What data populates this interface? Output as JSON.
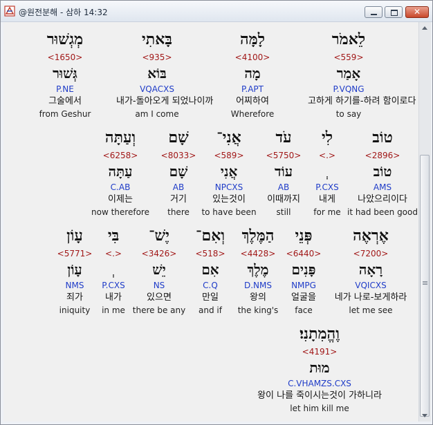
{
  "window": {
    "title": "@원전분해 - 삼하 14:32"
  },
  "rows": [
    [
      {
        "hebrew": "מְגְשׁוּר",
        "strong": "<1650>",
        "root": "גְּשׁוּר",
        "morph": "P.NE",
        "korean": "그술에서",
        "english": "from Geshur"
      },
      {
        "hebrew": "בָּאתִי",
        "strong": "<935>",
        "root": "בּוֹא",
        "morph": "VQACXS",
        "korean": "내가-돌아오게 되었나이까",
        "english": "am I come"
      },
      {
        "hebrew": "לָמָּה",
        "strong": "<4100>",
        "root": "מָה",
        "morph": "P.APT",
        "korean": "어찌하여",
        "english": "Wherefore"
      },
      {
        "hebrew": "לֵאמֹר",
        "strong": "<559>",
        "root": "אָמַר",
        "morph": "P.VQNG",
        "korean": "고하게 하기를-하려 함이로다",
        "english": "to say"
      }
    ],
    [
      {
        "hebrew": "וְעַתָּה",
        "strong": "<6258>",
        "root": "עַתָּה",
        "morph": "C.AB",
        "korean": "이제는",
        "english": "now therefore"
      },
      {
        "hebrew": "שָׁם",
        "strong": "<8033>",
        "root": "שָׁם",
        "morph": "AB",
        "korean": "거기",
        "english": "there"
      },
      {
        "hebrew": "אֲנִי־",
        "strong": "<589>",
        "root": "אֲנִי",
        "morph": "NPCXS",
        "korean": "있는것이",
        "english": "to have been"
      },
      {
        "hebrew": "עֹד",
        "strong": "<5750>",
        "root": "עוֹד",
        "morph": "AB",
        "korean": "이때까지",
        "english": "still"
      },
      {
        "hebrew": "לִי",
        "strong": "<.>",
        "root": "ְ",
        "morph": "P.CXS",
        "korean": "내게",
        "english": "for me"
      },
      {
        "hebrew": "טוֹב",
        "strong": "<2896>",
        "root": "טוֹב",
        "morph": "AMS",
        "korean": "나았으리이다",
        "english": "it had been good"
      }
    ],
    [
      {
        "hebrew": "עָוֹן",
        "strong": "<5771>",
        "root": "עָוֹן",
        "morph": "NMS",
        "korean": "죄가",
        "english": "iniquity"
      },
      {
        "hebrew": "בִּי",
        "strong": "<.>",
        "root": "ְ",
        "morph": "P.CXS",
        "korean": "내가",
        "english": "in me"
      },
      {
        "hebrew": "יֶשׁ־",
        "strong": "<3426>",
        "root": "יֵשׁ",
        "morph": "NS",
        "korean": "있으면",
        "english": "there be any"
      },
      {
        "hebrew": "וְאִם־",
        "strong": "<518>",
        "root": "אִם",
        "morph": "C.Q",
        "korean": "만일",
        "english": "and if"
      },
      {
        "hebrew": "הַמֶּלֶךְ",
        "strong": "<4428>",
        "root": "מֶלֶךְ",
        "morph": "D.NMS",
        "korean": "왕의",
        "english": "the king's"
      },
      {
        "hebrew": "פְּנֵי",
        "strong": "<6440>",
        "root": "פָּנִים",
        "morph": "NMPG",
        "korean": "얼굴을",
        "english": "face"
      },
      {
        "hebrew": "אֶרְאֶה",
        "strong": "<7200>",
        "root": "רָאָה",
        "morph": "VQICXS",
        "korean": "네가 나로-보게하라",
        "english": "let me see"
      }
    ],
    [
      {
        "hebrew": "וֶהֱמִתָנִי׃",
        "strong": "<4191>",
        "root": "מוּת",
        "morph": "C.VHAMZS.CXS",
        "korean": "왕이 나를 죽이시는것이 가하니라",
        "english": "let him kill me"
      }
    ]
  ]
}
